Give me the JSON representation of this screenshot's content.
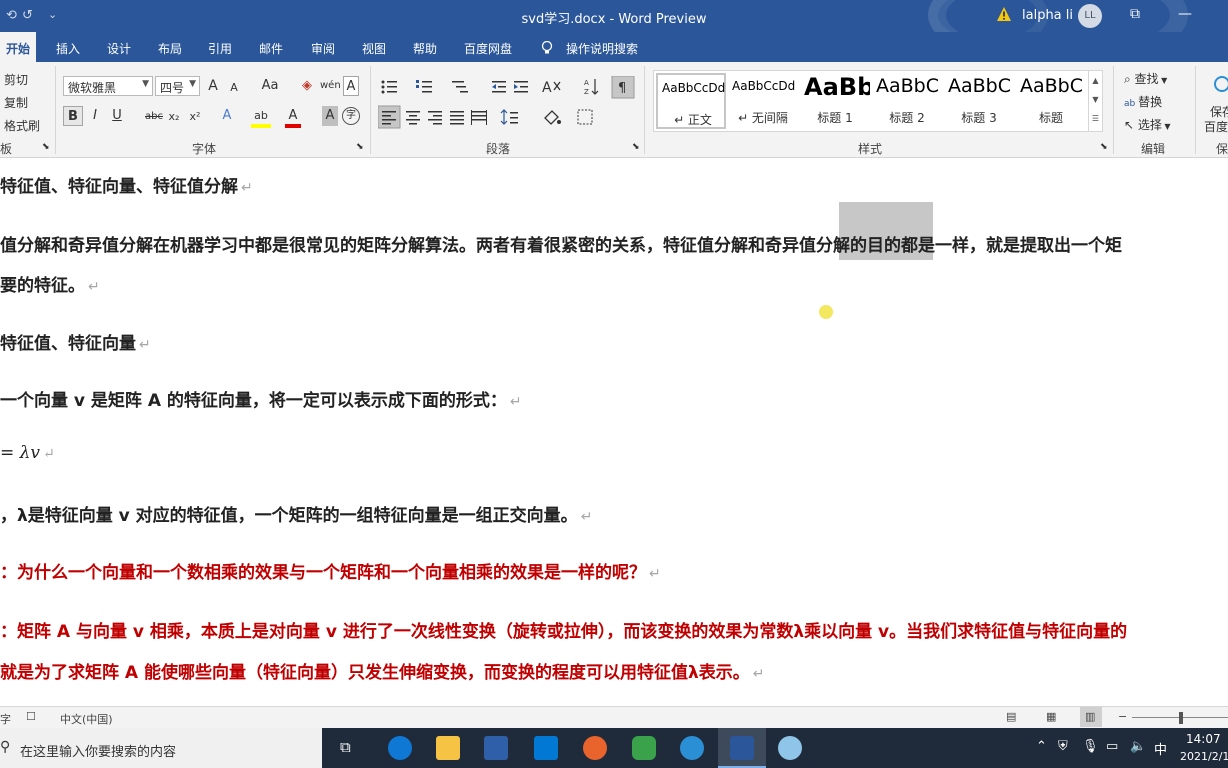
{
  "titlebar": {
    "quick_access": [
      "⟲",
      "↺",
      "⌄"
    ],
    "document_title": "svd学习.docx  -  Word Preview",
    "user_name": "lalpha li",
    "avatar_initials": "LL",
    "buttons": [
      "⧉",
      "—"
    ]
  },
  "tabs": [
    "开始",
    "插入",
    "设计",
    "布局",
    "引用",
    "邮件",
    "审阅",
    "视图",
    "帮助",
    "百度网盘",
    "操作说明搜索"
  ],
  "ribbon": {
    "clipboard": {
      "cut": "剪切",
      "copy": "复制",
      "format_painter": "格式刷",
      "label": "板"
    },
    "font": {
      "font_name": "微软雅黑",
      "font_size": "四号",
      "grow": "A",
      "shrink": "A",
      "case": "Aa",
      "clear": "◈",
      "phonetic": "wén",
      "border_char": "A",
      "bold": "B",
      "italic": "I",
      "underline": "U",
      "strike": "abc",
      "sub": "x₂",
      "sup": "x²",
      "effects": "A",
      "highlight": "ab",
      "font_color": "A",
      "shading": "A",
      "enclose": "字",
      "label": "字体"
    },
    "paragraph": {
      "label": "段落"
    },
    "styles": {
      "label": "样式",
      "items": [
        {
          "sample": "AaBbCcDd",
          "name": "↵ 正文"
        },
        {
          "sample": "AaBbCcDd",
          "name": "↵ 无间隔"
        },
        {
          "sample": "AaBb",
          "name": "标题 1"
        },
        {
          "sample": "AaBbC",
          "name": "标题 2"
        },
        {
          "sample": "AaBbC",
          "name": "标题 3"
        },
        {
          "sample": "AaBbC",
          "name": "标题"
        }
      ]
    },
    "editing": {
      "find": "查找",
      "replace": "替换",
      "select": "选择",
      "label": "编辑"
    },
    "save": {
      "line1": "保存",
      "line2": "百度",
      "label": "保"
    }
  },
  "document": {
    "heading1": "特征值、特征向量、特征值分解",
    "para1_line1": "值分解和奇异值分解在机器学习中都是很常见的矩阵分解算法。两者有着很紧密的关系，特征值分解和奇异值分解的目的都是一样，就是提取出一个矩",
    "para1_line2": "要的特征。",
    "heading2": "特征值、特征向量",
    "para2": "一个向量 v 是矩阵 A 的特征向量，将一定可以表示成下面的形式：",
    "formula": "= λv",
    "para3": "，λ是特征向量 v 对应的特征值，一个矩阵的一组特征向量是一组正交向量。",
    "question": "：为什么一个向量和一个数相乘的效果与一个矩阵和一个向量相乘的效果是一样的呢？",
    "answer_line1": "：矩阵 A 与向量 v 相乘，本质上是对向量 v 进行了一次线性变换（旋转或拉伸），而该变换的效果为常数λ乘以向量 v。当我们求特征值与特征向量的",
    "answer_line2": "就是为了求矩阵 A 能使哪些向量（特征向量）只发生伸缩变换，而变换的程度可以用特征值λ表示。",
    "paragraph_mark": "↵"
  },
  "statusbar": {
    "words": "字",
    "language": "中文(中国)",
    "zoom_minus": "−"
  },
  "taskbar": {
    "search_placeholder": "在这里输入你要搜索的内容",
    "time": "14:07",
    "date": "2021/2/1",
    "ime": "中",
    "colors": {
      "accent": "#2b579a",
      "taskbar": "#1f2b3a"
    }
  }
}
